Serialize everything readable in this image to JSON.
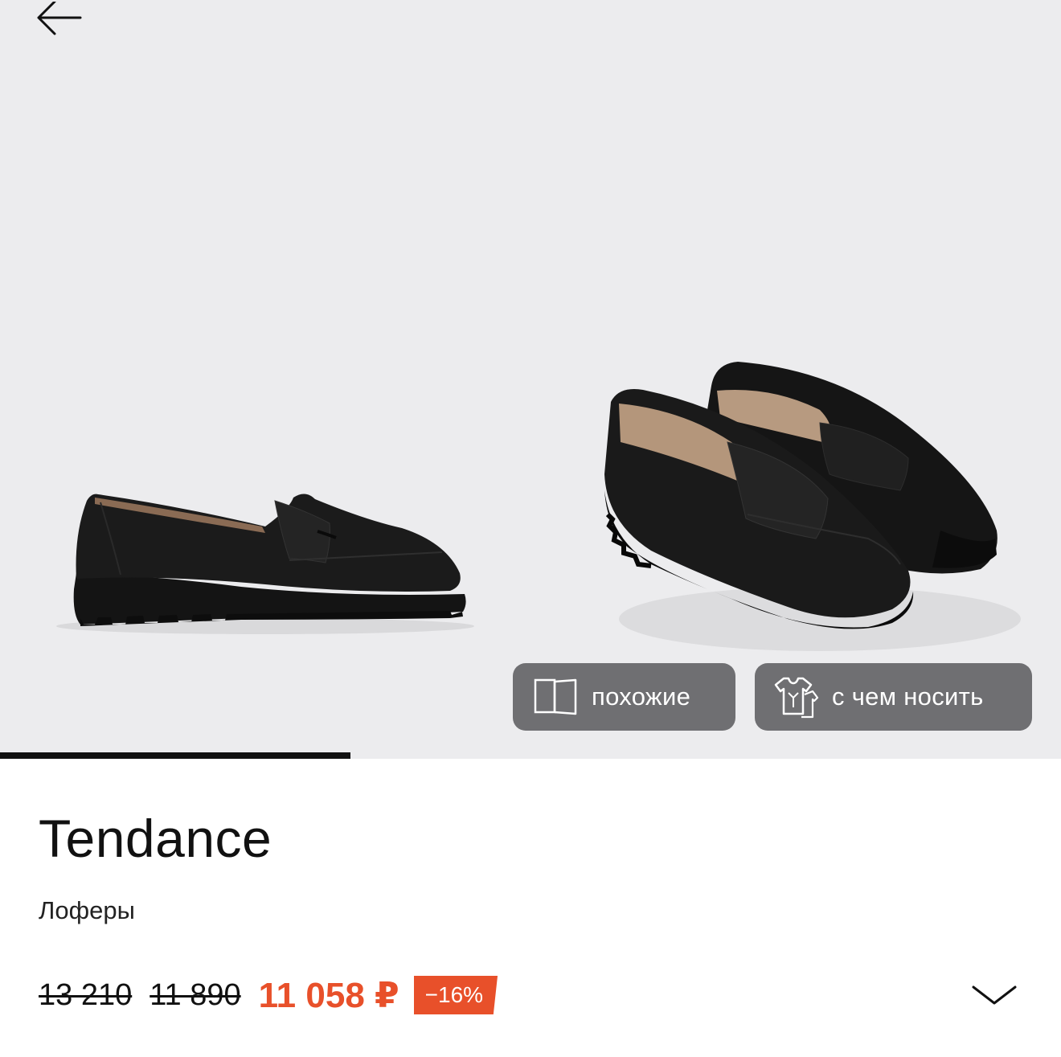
{
  "gallery": {
    "progress_fraction": 0.33,
    "chips": {
      "similar_label": "похожие",
      "wear_with_label": "с чем носить"
    }
  },
  "product": {
    "brand": "Tendance",
    "category": "Лоферы",
    "prices": {
      "old_price_1": "13 210",
      "old_price_2": "11 890",
      "current_price": "11 058 ₽",
      "discount": "−16%"
    }
  },
  "icons": {
    "back": "arrow-left-icon",
    "similar": "cards-icon",
    "wear_with": "clothes-icon",
    "expand": "chevron-down-icon"
  },
  "colors": {
    "accent": "#e8502a",
    "chip_background": "#6f6f72",
    "gallery_background": "#ececee"
  }
}
